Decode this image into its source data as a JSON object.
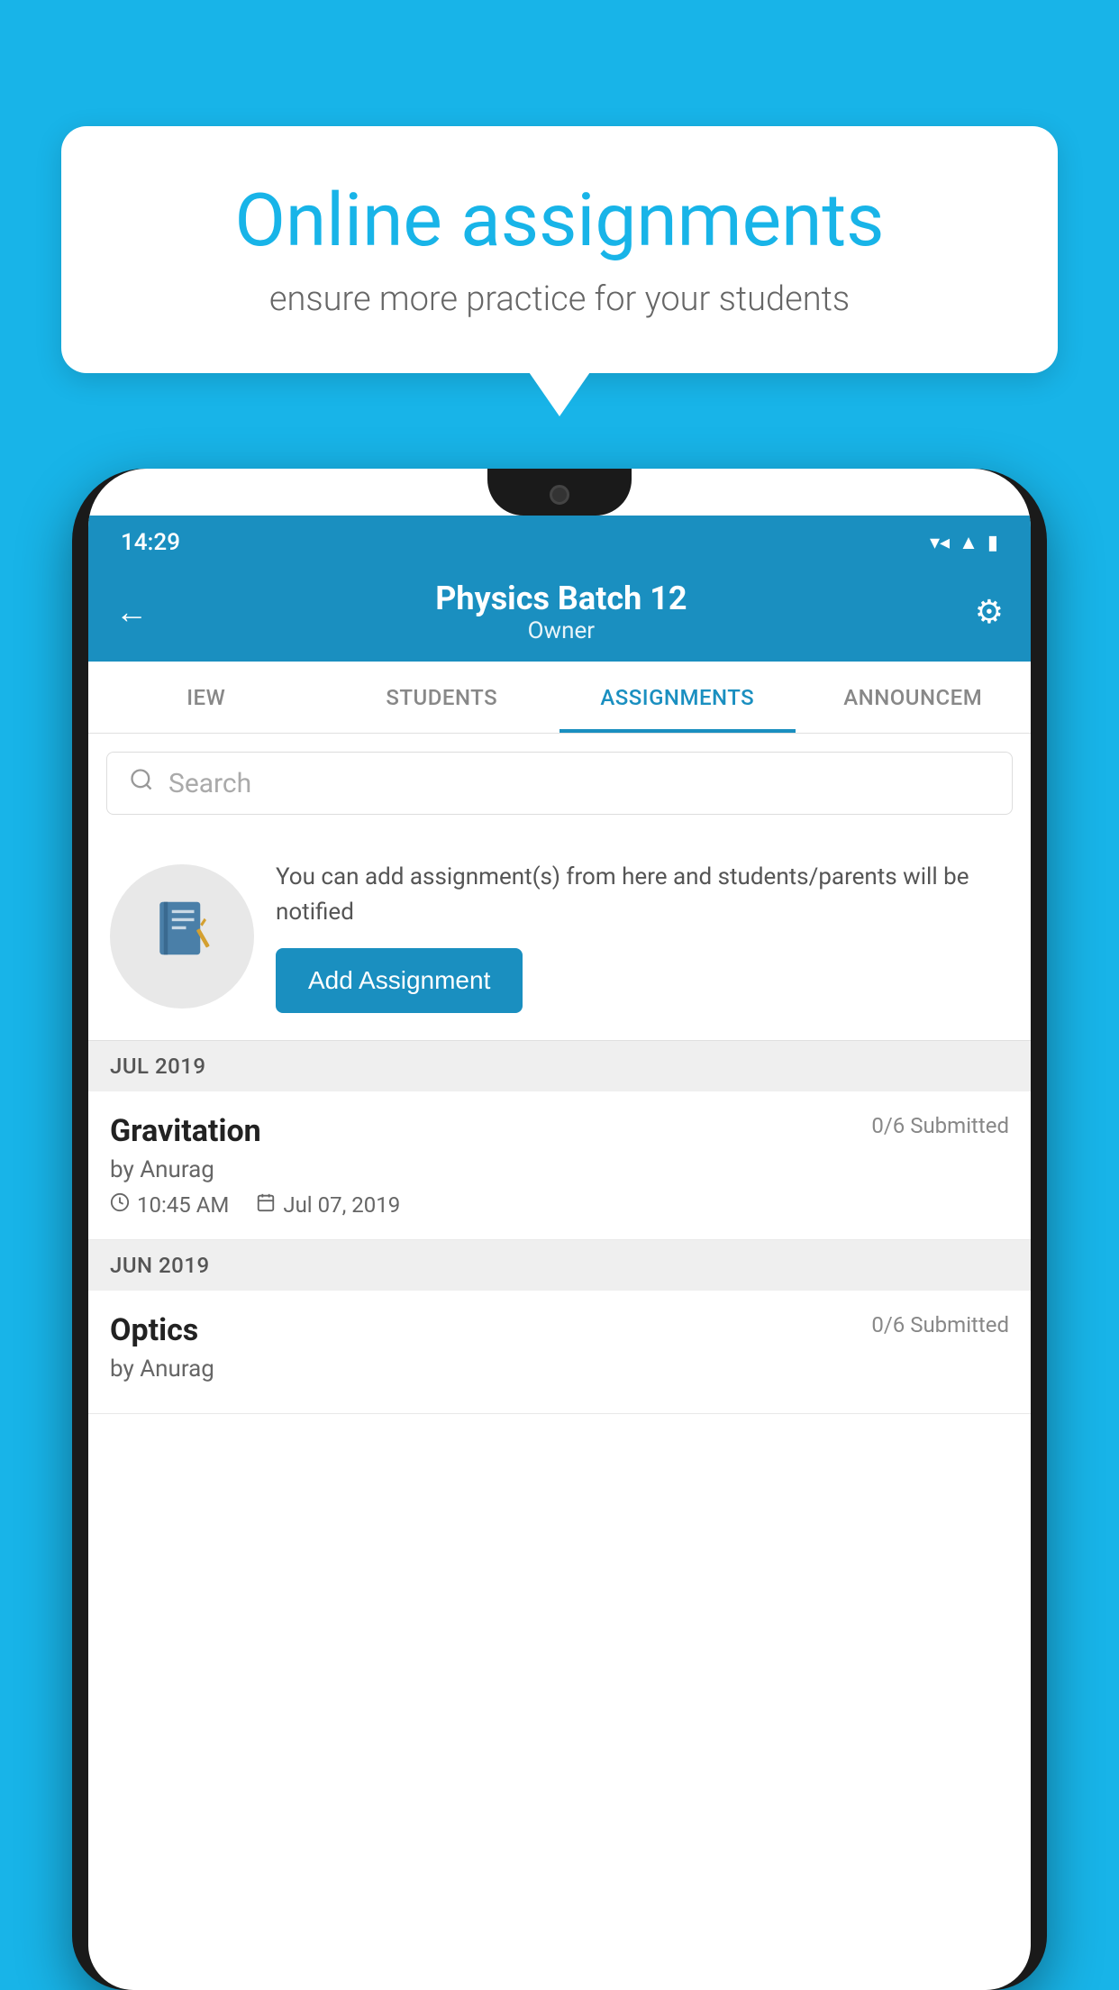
{
  "background_color": "#18b4e8",
  "speech_bubble": {
    "title": "Online assignments",
    "subtitle": "ensure more practice for your students"
  },
  "status_bar": {
    "time": "14:29",
    "icons": [
      "wifi",
      "signal",
      "battery"
    ]
  },
  "header": {
    "title": "Physics Batch 12",
    "subtitle": "Owner",
    "back_label": "←",
    "settings_label": "⚙"
  },
  "tabs": [
    {
      "label": "IEW",
      "active": false
    },
    {
      "label": "STUDENTS",
      "active": false
    },
    {
      "label": "ASSIGNMENTS",
      "active": true
    },
    {
      "label": "ANNOUNCEM",
      "active": false
    }
  ],
  "search": {
    "placeholder": "Search"
  },
  "promo": {
    "text": "You can add assignment(s) from here and students/parents will be notified",
    "button_label": "Add Assignment"
  },
  "sections": [
    {
      "month_label": "JUL 2019",
      "assignments": [
        {
          "name": "Gravitation",
          "submitted": "0/6 Submitted",
          "by": "by Anurag",
          "time": "10:45 AM",
          "date": "Jul 07, 2019"
        }
      ]
    },
    {
      "month_label": "JUN 2019",
      "assignments": [
        {
          "name": "Optics",
          "submitted": "0/6 Submitted",
          "by": "by Anurag",
          "time": "",
          "date": ""
        }
      ]
    }
  ]
}
